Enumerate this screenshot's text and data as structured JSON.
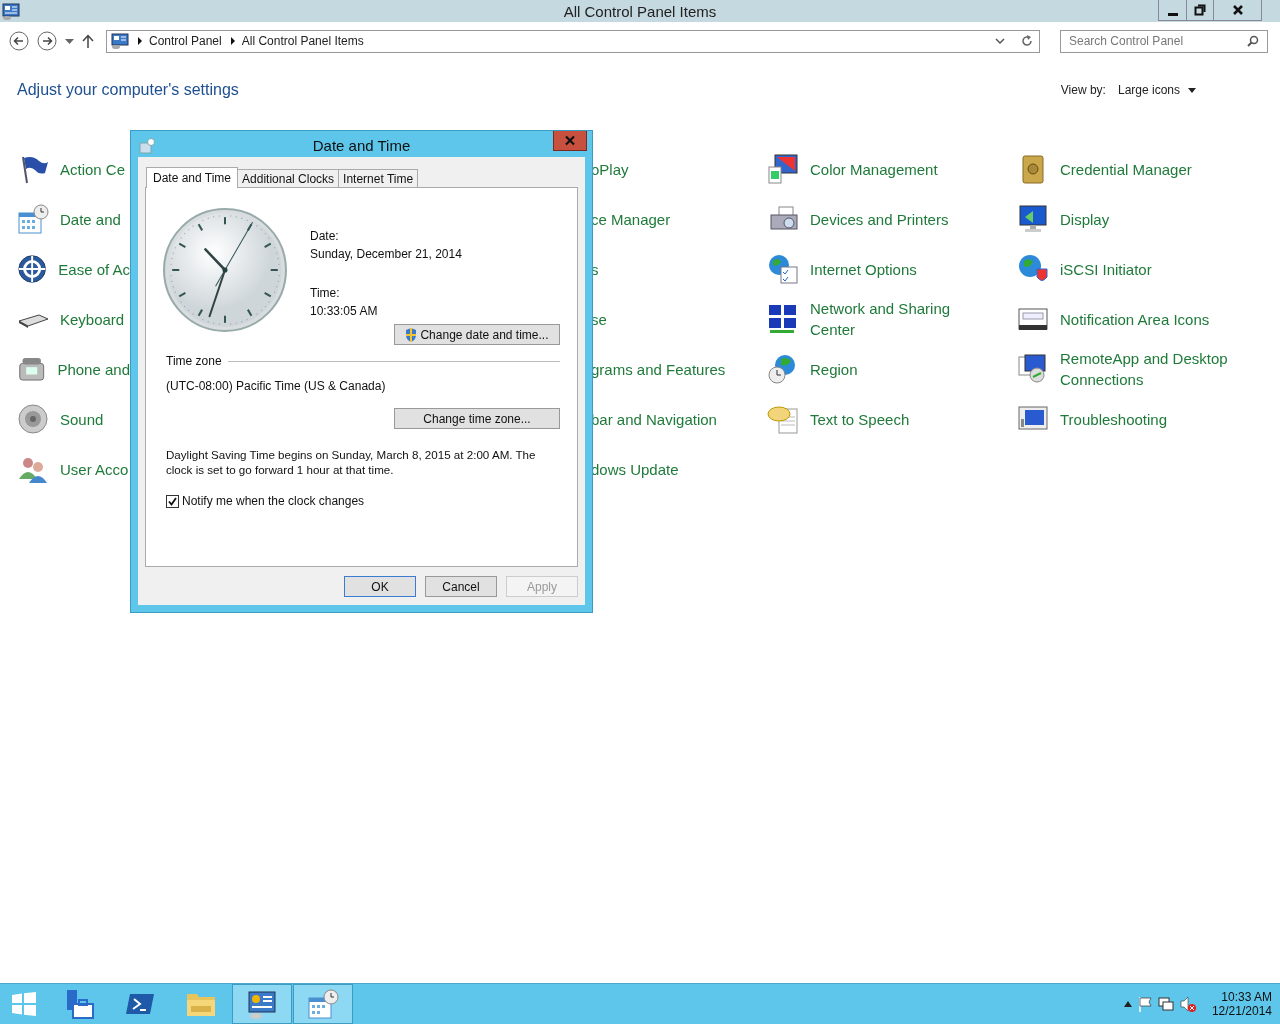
{
  "window": {
    "title": "All Control Panel Items"
  },
  "address_bar": {
    "breadcrumbs": [
      "Control Panel",
      "All Control Panel Items"
    ]
  },
  "search": {
    "placeholder": "Search Control Panel"
  },
  "heading": "Adjust your computer's settings",
  "view_by": {
    "label": "View by:",
    "value": "Large icons"
  },
  "columns": [
    {
      "items": [
        "Action Ce",
        "Date and",
        "Ease of Ac",
        "Keyboard",
        "Phone and",
        "Sound",
        "User Acco"
      ]
    },
    {
      "items": [
        "oPlay",
        "ce Manager",
        "s",
        "se",
        "grams and Features",
        "bar and Navigation",
        "dows Update"
      ]
    },
    {
      "items": [
        "Color Management",
        "Devices and Printers",
        "Internet Options",
        "Network and Sharing Center",
        "Region",
        "Text to Speech"
      ]
    },
    {
      "items": [
        "Credential Manager",
        "Display",
        "iSCSI Initiator",
        "Notification Area Icons",
        "RemoteApp and Desktop Connections",
        "Troubleshooting"
      ]
    }
  ],
  "dialog": {
    "title": "Date and Time",
    "tabs": [
      {
        "label": "Date and Time",
        "selected": true
      },
      {
        "label": "Additional Clocks",
        "selected": false
      },
      {
        "label": "Internet Time",
        "selected": false
      }
    ],
    "date_label": "Date:",
    "date": "Sunday, December 21, 2014",
    "time_label": "Time:",
    "time": "10:33:05 AM",
    "change_datetime_button": "Change date and time...",
    "timezone_heading": "Time zone",
    "timezone": "(UTC-08:00) Pacific Time (US & Canada)",
    "change_timezone_button": "Change time zone...",
    "dst_note": "Daylight Saving Time begins on Sunday, March 8, 2015 at 2:00 AM. The clock is set to go forward 1 hour at that time.",
    "notify": {
      "label": "Notify me when the clock changes",
      "checked": true
    },
    "buttons": [
      {
        "label": "OK",
        "default": true,
        "disabled": false
      },
      {
        "label": "Cancel",
        "default": false,
        "disabled": false
      },
      {
        "label": "Apply",
        "default": false,
        "disabled": true
      }
    ]
  },
  "taskbar": {
    "apps": [
      {
        "selected": false
      },
      {
        "selected": false
      },
      {
        "selected": false
      },
      {
        "selected": true
      },
      {
        "selected": true
      }
    ],
    "clock": {
      "time": "10:33 AM",
      "date": "12/21/2014"
    }
  }
}
